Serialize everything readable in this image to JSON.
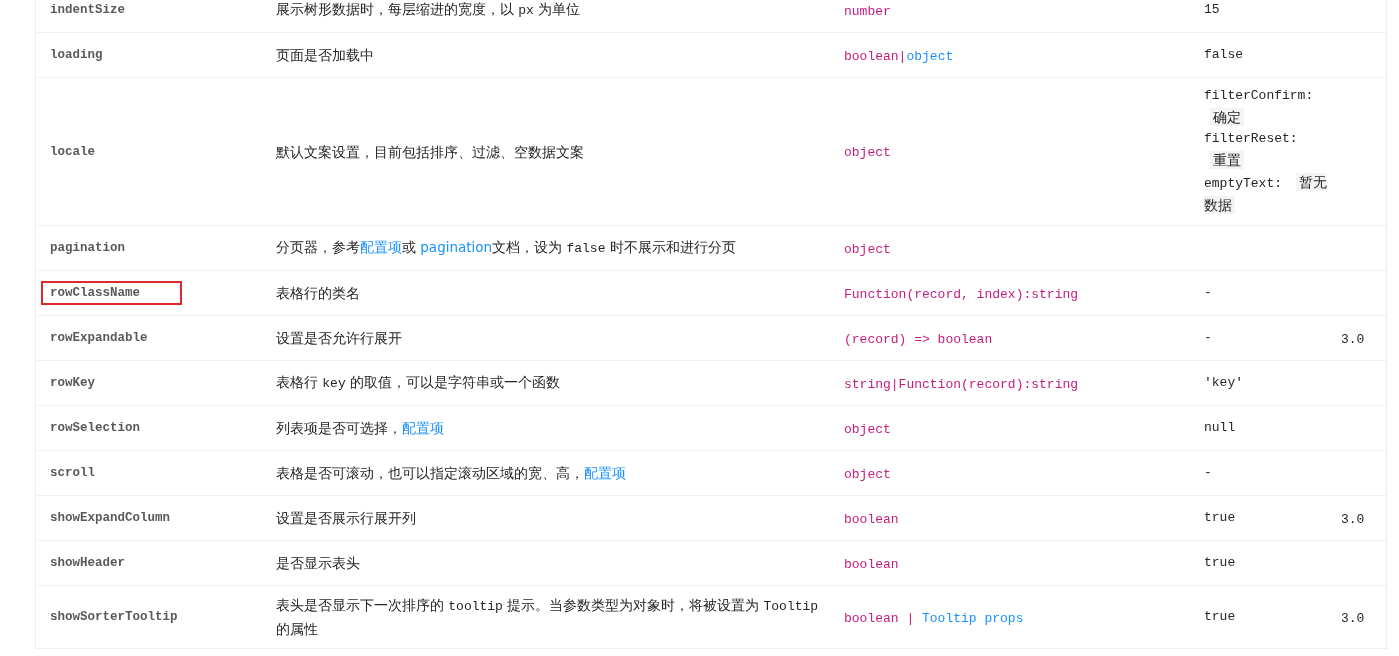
{
  "rows": [
    {
      "name": "indentSize",
      "outlined": false,
      "description": [
        {
          "kind": "text",
          "text": "展示树形数据时，每层缩进的宽度，以 "
        },
        {
          "kind": "code",
          "text": "px"
        },
        {
          "kind": "text",
          "text": " 为单位"
        }
      ],
      "type": [
        {
          "kind": "type",
          "text": "number"
        }
      ],
      "default": [
        {
          "kind": "code",
          "text": "15"
        }
      ]
    },
    {
      "name": "loading",
      "outlined": false,
      "description": [
        {
          "kind": "text",
          "text": "页面是否加载中"
        }
      ],
      "type": [
        {
          "kind": "type",
          "text": "boolean|"
        },
        {
          "kind": "link",
          "text": "object"
        }
      ],
      "default": [
        {
          "kind": "code",
          "text": "false"
        }
      ]
    },
    {
      "name": "locale",
      "outlined": false,
      "description": [
        {
          "kind": "text",
          "text": "默认文案设置，目前包括排序、过滤、空数据文案"
        }
      ],
      "type": [
        {
          "kind": "type",
          "text": "object"
        }
      ],
      "default": [
        {
          "kind": "code",
          "text": "filterConfirm: "
        },
        {
          "kind": "tag",
          "text": "确定"
        },
        {
          "kind": "code",
          "text": "filterReset: "
        },
        {
          "kind": "tag",
          "text": "重置"
        },
        {
          "kind": "code",
          "text": "emptyText: "
        },
        {
          "kind": "tag",
          "text": "暂无数据"
        }
      ]
    },
    {
      "name": "pagination",
      "outlined": false,
      "description": [
        {
          "kind": "text",
          "text": "分页器，参考"
        },
        {
          "kind": "link",
          "text": "配置项"
        },
        {
          "kind": "text",
          "text": "或 "
        },
        {
          "kind": "link",
          "text": "pagination"
        },
        {
          "kind": "text",
          "text": "文档，设为 "
        },
        {
          "kind": "code",
          "text": "false"
        },
        {
          "kind": "text",
          "text": " 时不展示和进行分页"
        }
      ],
      "type": [
        {
          "kind": "type",
          "text": "object"
        }
      ]
    },
    {
      "name": "rowClassName",
      "outlined": true,
      "description": [
        {
          "kind": "text",
          "text": "表格行的类名"
        }
      ],
      "type": [
        {
          "kind": "type",
          "text": "Function(record, index):string"
        }
      ],
      "default": [
        {
          "kind": "code",
          "text": "-"
        }
      ]
    },
    {
      "name": "rowExpandable",
      "outlined": false,
      "description": [
        {
          "kind": "text",
          "text": "设置是否允许行展开"
        }
      ],
      "type": [
        {
          "kind": "type",
          "text": "(record) => boolean"
        }
      ],
      "default": [
        {
          "kind": "code",
          "text": "-"
        }
      ],
      "version": "3.0"
    },
    {
      "name": "rowKey",
      "outlined": false,
      "description": [
        {
          "kind": "text",
          "text": "表格行 "
        },
        {
          "kind": "code",
          "text": "key"
        },
        {
          "kind": "text",
          "text": " 的取值，可以是字符串或一个函数"
        }
      ],
      "type": [
        {
          "kind": "type",
          "text": "string|Function(record):string"
        }
      ],
      "default": [
        {
          "kind": "code",
          "text": "'key'"
        }
      ]
    },
    {
      "name": "rowSelection",
      "outlined": false,
      "description": [
        {
          "kind": "text",
          "text": "列表项是否可选择，"
        },
        {
          "kind": "link",
          "text": "配置项"
        }
      ],
      "type": [
        {
          "kind": "type",
          "text": "object"
        }
      ],
      "default": [
        {
          "kind": "code",
          "text": "null"
        }
      ]
    },
    {
      "name": "scroll",
      "outlined": false,
      "description": [
        {
          "kind": "text",
          "text": "表格是否可滚动，也可以指定滚动区域的宽、高，"
        },
        {
          "kind": "link",
          "text": "配置项"
        }
      ],
      "type": [
        {
          "kind": "type",
          "text": "object"
        }
      ],
      "default": [
        {
          "kind": "code",
          "text": "-"
        }
      ]
    },
    {
      "name": "showExpandColumn",
      "outlined": false,
      "description": [
        {
          "kind": "text",
          "text": "设置是否展示行展开列"
        }
      ],
      "type": [
        {
          "kind": "type",
          "text": "boolean"
        }
      ],
      "default": [
        {
          "kind": "code",
          "text": "true"
        }
      ],
      "version": "3.0"
    },
    {
      "name": "showHeader",
      "outlined": false,
      "description": [
        {
          "kind": "text",
          "text": "是否显示表头"
        }
      ],
      "type": [
        {
          "kind": "type",
          "text": "boolean"
        }
      ],
      "default": [
        {
          "kind": "code",
          "text": "true"
        }
      ]
    },
    {
      "name": "showSorterTooltip",
      "outlined": false,
      "description": [
        {
          "kind": "text",
          "text": "表头是否显示下一次排序的 "
        },
        {
          "kind": "code",
          "text": "tooltip"
        },
        {
          "kind": "text",
          "text": " 提示。当参数类型为对象时，将被设置为 "
        },
        {
          "kind": "code",
          "text": "Tooltip"
        },
        {
          "kind": "text",
          "text": " 的属性"
        }
      ],
      "type": [
        {
          "kind": "type",
          "text": "boolean | "
        },
        {
          "kind": "link",
          "text": "Tooltip props"
        }
      ],
      "default": [
        {
          "kind": "code",
          "text": "true"
        }
      ],
      "version": "3.0"
    }
  ]
}
